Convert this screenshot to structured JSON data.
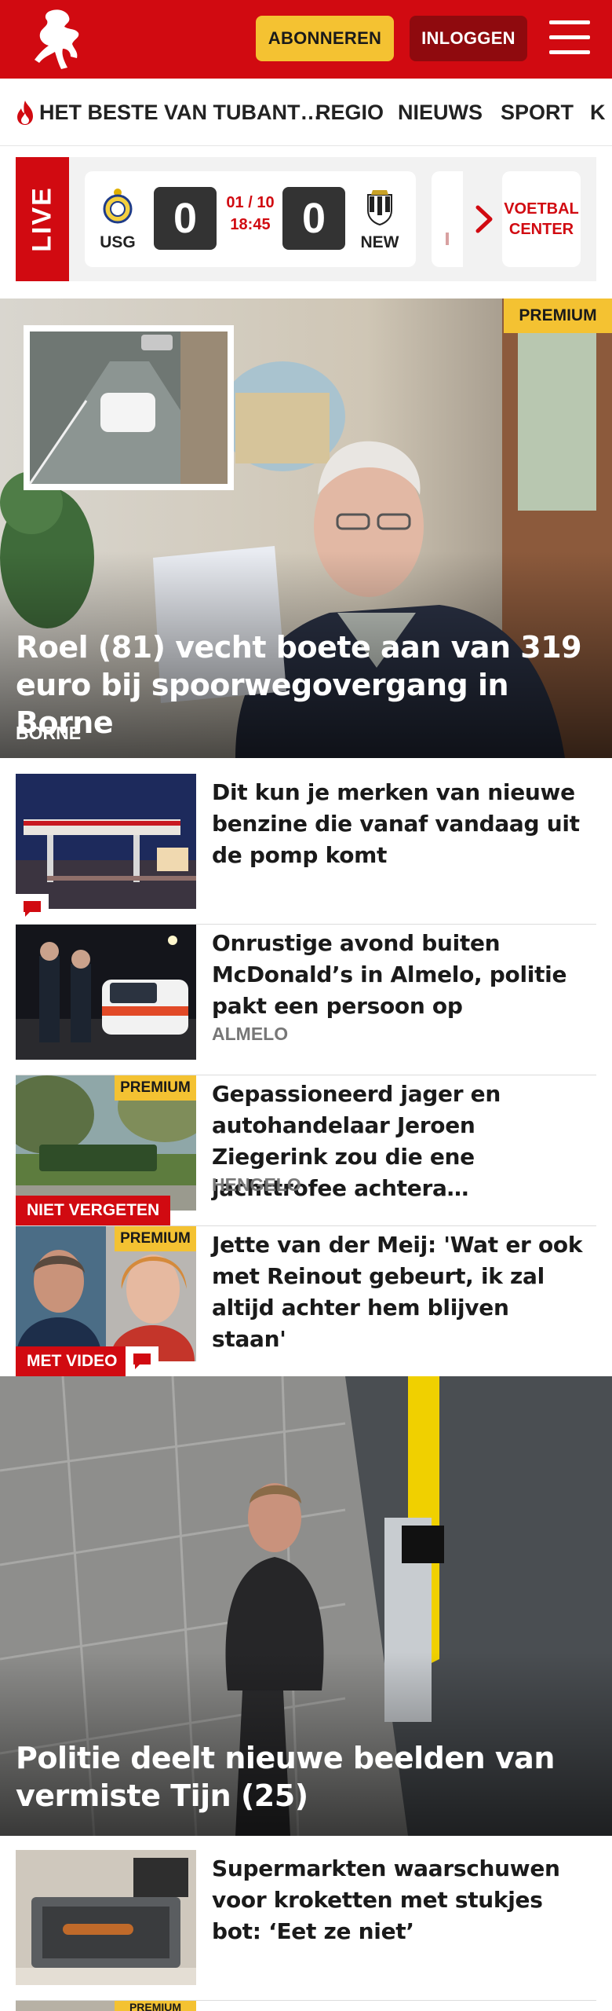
{
  "header": {
    "subscribe_label": "ABONNEREN",
    "login_label": "INLOGGEN",
    "brand_color": "#d10a11",
    "icons": [
      "tubantia-horse-logo",
      "hamburger-menu-icon"
    ]
  },
  "nav": {
    "items": [
      {
        "label": "HET BESTE VAN TUBANT…",
        "icon": "flame-icon"
      },
      {
        "label": "REGIO"
      },
      {
        "label": "NIEUWS"
      },
      {
        "label": "SPORT"
      },
      {
        "label": "K"
      }
    ]
  },
  "live": {
    "tag": "LIVE",
    "match": {
      "home": "USG",
      "away": "NEW",
      "home_score": "0",
      "away_score": "0",
      "date": "01 / 10",
      "time": "18:45"
    },
    "cta_line1": "VOETBAL",
    "cta_line2": "CENTER"
  },
  "hero": {
    "badge": "PREMIUM",
    "title": "Roel (81) vecht boete aan van 319 euro bij spoorwegovergang in Borne",
    "location": "BORNE"
  },
  "articles": [
    {
      "title": "Dit kun je merken van nieuwe benzine die vanaf vandaag uit de pomp komt",
      "location": "",
      "badge": "",
      "label": "",
      "comments": true
    },
    {
      "title": "Onrustige avond buiten McDonald’s in Almelo, politie pakt een persoon op",
      "location": "ALMELO",
      "badge": "",
      "label": "",
      "comments": false
    },
    {
      "title": "Gepassioneerd jager en autohandelaar Jeroen Ziegerink zou die ene jachttrofee achtera…",
      "location": "HENGELO",
      "badge": "PREMIUM",
      "label": "NIET VERGETEN",
      "comments": false
    },
    {
      "title": "Jette van der Meij: 'Wat er ook met Reinout gebeurt, ik zal altijd achter hem blijven staan'",
      "location": "",
      "badge": "PREMIUM",
      "label": "MET VIDEO",
      "comments": true
    }
  ],
  "hero2": {
    "title": "Politie deelt nieuwe beelden van vermiste Tijn (25)"
  },
  "articles2": [
    {
      "title": "Supermarkten waarschuwen voor kroketten met stukjes bot: ‘Eet ze niet’"
    },
    {
      "badge": "PREMIUM"
    }
  ]
}
